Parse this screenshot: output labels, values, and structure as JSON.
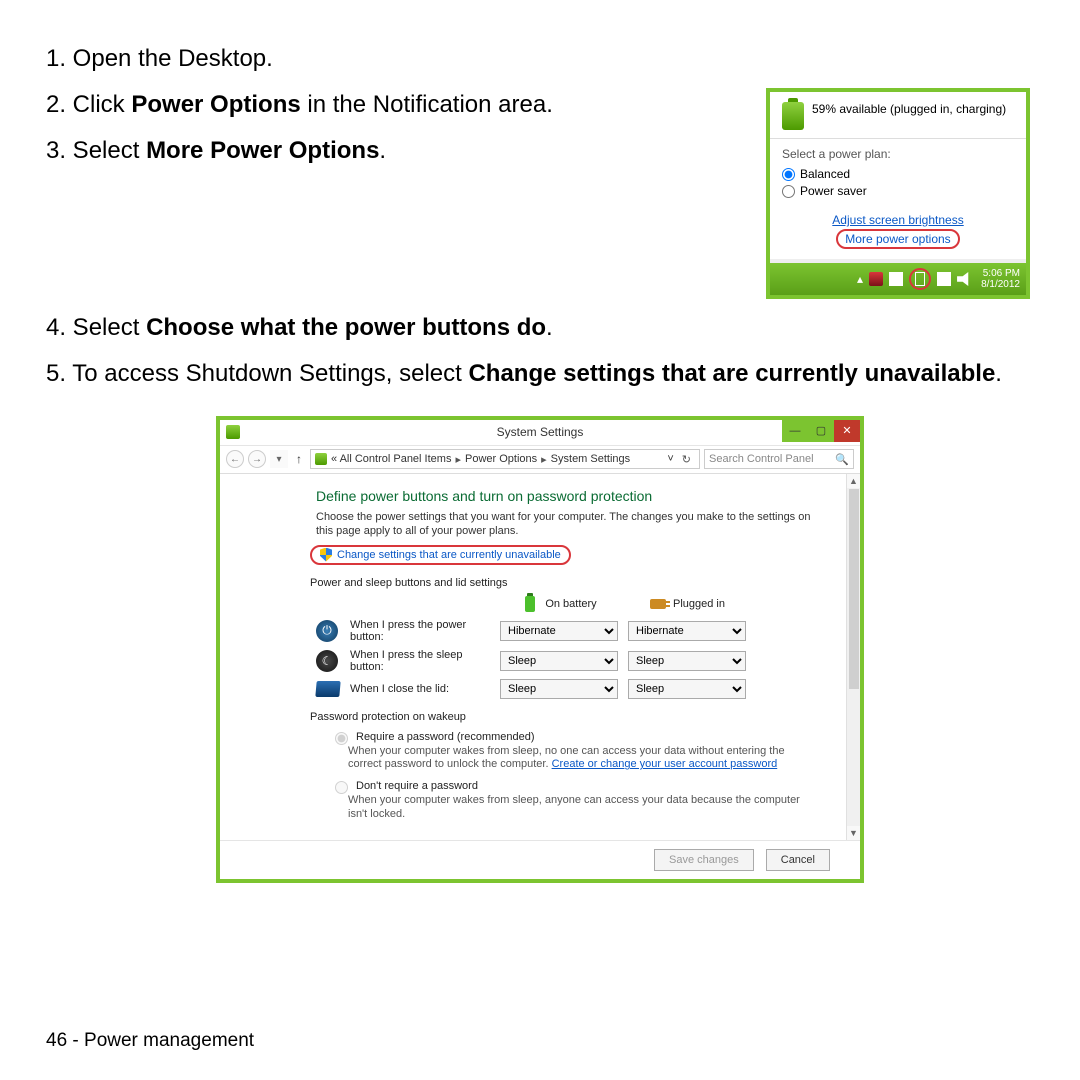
{
  "steps": {
    "one_a": "1. Open the Desktop.",
    "two_a": "2. Click ",
    "two_b": "Power Options",
    "two_c": " in the Notification area.",
    "three_a": "3. Select ",
    "three_b": "More Power Options",
    "three_c": ".",
    "four_a": "4. Select ",
    "four_b": "Choose what the power buttons do",
    "four_c": ".",
    "five_a": "5. To access Shutdown Settings, select ",
    "five_b": "Change settings that are currently unavailable",
    "five_c": "."
  },
  "popup": {
    "status": "59% available (plugged in, charging)",
    "plan_title": "Select a power plan:",
    "plan_balanced": "Balanced",
    "plan_saver": "Power saver",
    "link_brightness": "Adjust screen brightness",
    "link_more": "More power options",
    "time": "5:06 PM",
    "date": "8/1/2012"
  },
  "win": {
    "title": "System Settings",
    "breadcrumb_prefix": "«  All Control Panel Items",
    "breadcrumb_mid": "Power Options",
    "breadcrumb_leaf": "System Settings",
    "search_placeholder": "Search Control Panel",
    "section_title": "Define power buttons and turn on password protection",
    "section_desc": "Choose the power settings that you want for your computer. The changes you make to the settings on this page apply to all of your power plans.",
    "change_link": "Change settings that are currently unavailable",
    "subheader1": "Power and sleep buttons and lid settings",
    "col_battery": "On battery",
    "col_plugged": "Plugged in",
    "row_power_label": "When I press the power button:",
    "row_sleep_label": "When I press the sleep button:",
    "row_lid_label": "When I close the lid:",
    "val_hibernate": "Hibernate",
    "val_sleep": "Sleep",
    "subheader2": "Password protection on wakeup",
    "pw_require_label": "Require a password (recommended)",
    "pw_require_desc_a": "When your computer wakes from sleep, no one can access your data without entering the correct password to unlock the computer. ",
    "pw_require_link": "Create or change your user account password",
    "pw_dont_label": "Don't require a password",
    "pw_dont_desc": "When your computer wakes from sleep, anyone can access your data because the computer isn't locked.",
    "btn_save": "Save changes",
    "btn_cancel": "Cancel"
  },
  "footer": "46 - Power management"
}
